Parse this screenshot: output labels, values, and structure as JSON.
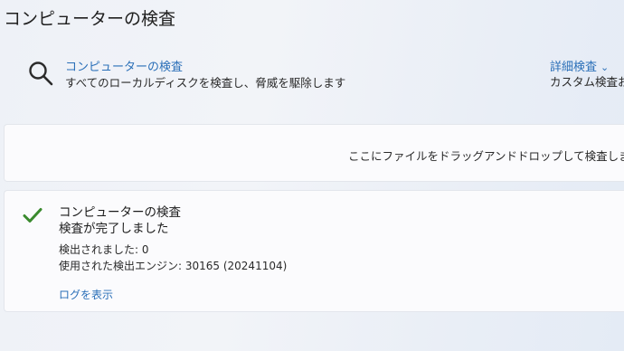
{
  "page": {
    "title": "コンピューターの検査"
  },
  "scan_option": {
    "title": "コンピューターの検査",
    "description": "すべてのローカルディスクを検査し、脅威を駆除します",
    "icon": "search-icon"
  },
  "advanced_scan": {
    "label": "詳細検査",
    "chevron": "⌄",
    "description": "カスタム検査お"
  },
  "drop_zone": {
    "text": "ここにファイルをドラッグアンドドロップして検査しま"
  },
  "result": {
    "icon": "check-icon",
    "accent_color": "#3a8a2e",
    "title": "コンピューターの検査",
    "status": "検査が完了しました",
    "detected": "検出されました: 0",
    "engine": "使用された検出エンジン: 30165 (20241104)",
    "view_log": "ログを表示"
  },
  "colors": {
    "link": "#2a6fb8",
    "card_background": "#fbfbfd"
  }
}
